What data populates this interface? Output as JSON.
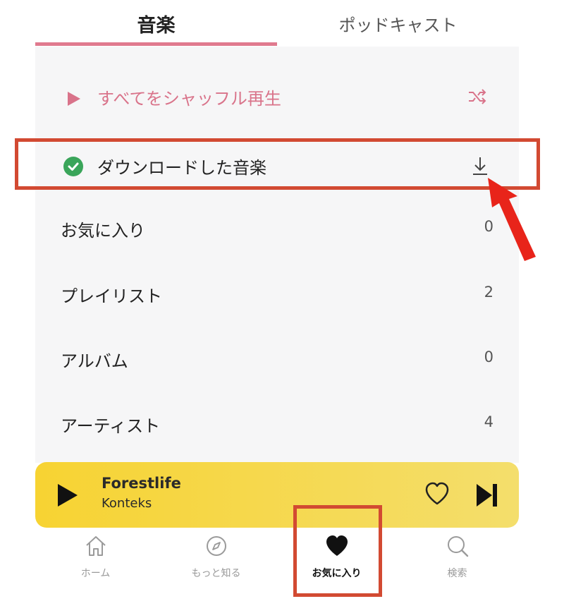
{
  "tabs": {
    "music": "音楽",
    "podcast": "ポッドキャスト",
    "active": "music"
  },
  "shuffle": {
    "label": "すべてをシャッフル再生",
    "play_icon": "play-triangle-icon",
    "shuffle_icon": "shuffle-icon"
  },
  "downloaded": {
    "label": "ダウンロードした音楽",
    "check_icon": "check-circle-icon",
    "download_icon": "download-icon"
  },
  "library": [
    {
      "label": "お気に入り",
      "count": "0"
    },
    {
      "label": "プレイリスト",
      "count": "2"
    },
    {
      "label": "アルバム",
      "count": "0"
    },
    {
      "label": "アーティスト",
      "count": "4"
    }
  ],
  "player": {
    "title": "Forestlife",
    "artist": "Konteks"
  },
  "nav": [
    {
      "label": "ホーム",
      "icon": "home-icon"
    },
    {
      "label": "もっと知る",
      "icon": "compass-icon"
    },
    {
      "label": "お気に入り",
      "icon": "heart-icon",
      "active": true
    },
    {
      "label": "検索",
      "icon": "search-icon"
    }
  ],
  "colors": {
    "accent": "#e07a8e",
    "highlight": "#d24a32",
    "player": "#f7d332",
    "check": "#3aa55a"
  }
}
